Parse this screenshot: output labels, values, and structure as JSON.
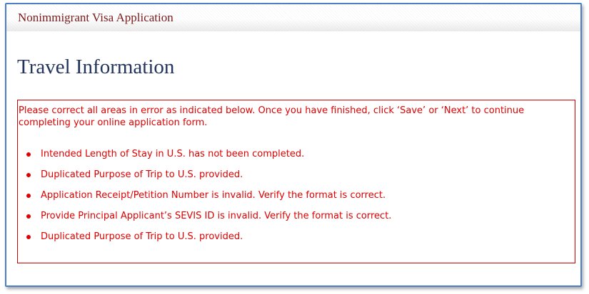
{
  "header": {
    "app_title": "Nonimmigrant Visa Application"
  },
  "main": {
    "page_title": "Travel Information",
    "error_box": {
      "intro": "Please correct all areas in error as indicated below. Once you have finished, click ‘Save’ or ‘Next’ to continue completing your online application form.",
      "errors": [
        "Intended Length of Stay in U.S. has not been completed.",
        "Duplicated Purpose of Trip to U.S. provided.",
        "Application Receipt/Petition Number is invalid. Verify the format is correct.",
        "Provide Principal Applicant’s SEVIS ID is invalid. Verify the format is correct.",
        "Duplicated Purpose of Trip to U.S. provided."
      ]
    }
  },
  "colors": {
    "frame_border": "#4d7fc9",
    "app_title": "#7a1a1a",
    "page_title": "#23355c",
    "error": "#e00000"
  }
}
